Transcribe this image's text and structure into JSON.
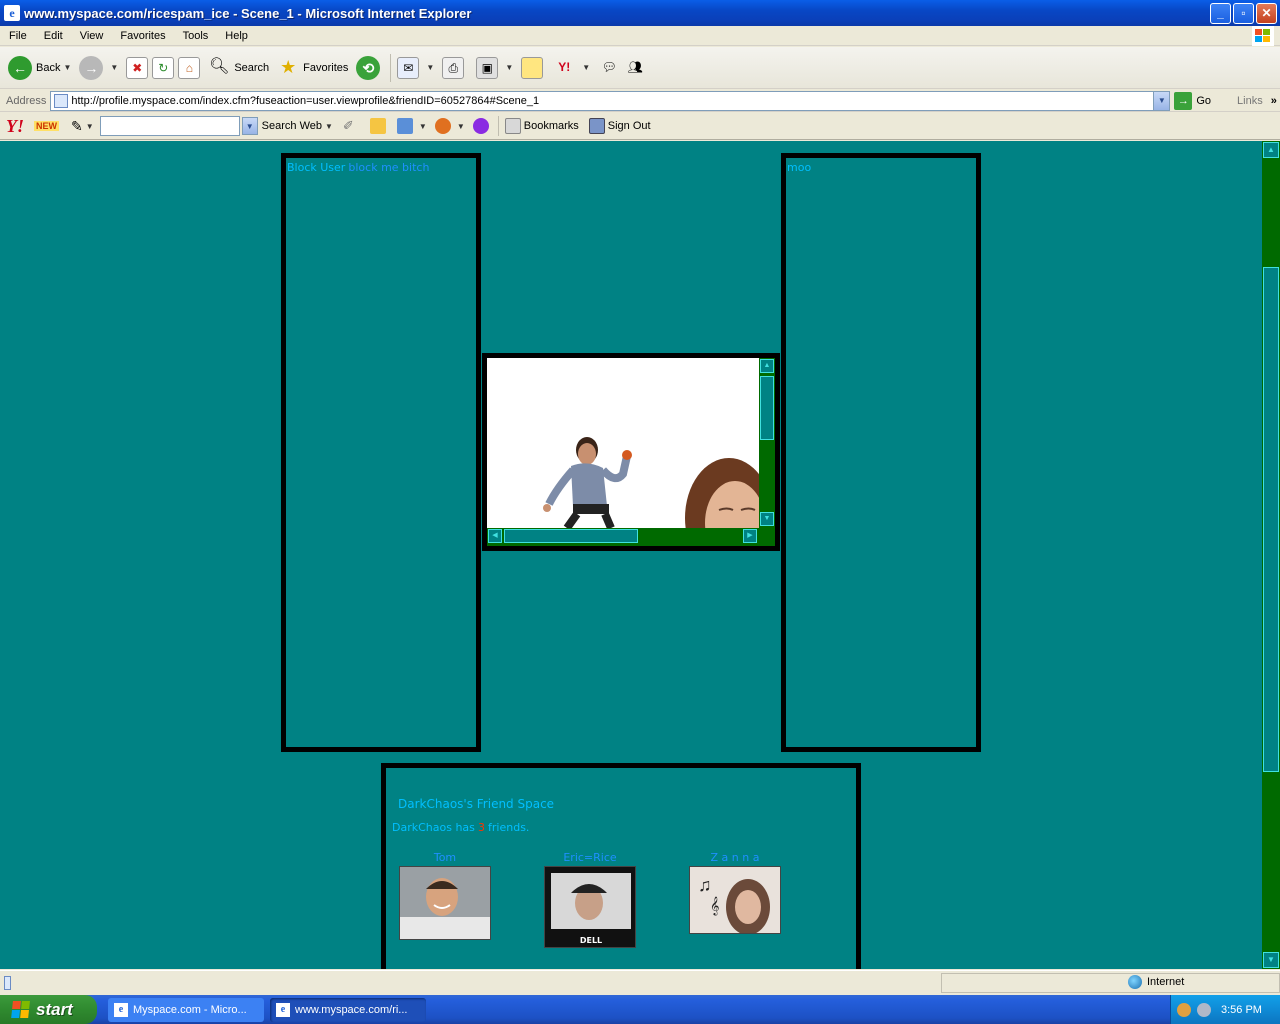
{
  "window": {
    "title": "www.myspace.com/ricespam_ice - Scene_1 - Microsoft Internet Explorer",
    "controls": [
      "minimize",
      "maximize",
      "close"
    ]
  },
  "menu": [
    "File",
    "Edit",
    "View",
    "Favorites",
    "Tools",
    "Help"
  ],
  "toolbar": {
    "back_label": "Back",
    "search_label": "Search",
    "favorites_label": "Favorites"
  },
  "address": {
    "label": "Address",
    "url": "http://profile.myspace.com/index.cfm?fuseaction=user.viewprofile&friendID=60527864#Scene_1",
    "go_label": "Go",
    "links_label": "Links"
  },
  "yahoo": {
    "logo": "Y!",
    "new_badge": "NEW",
    "search_web_label": "Search Web",
    "bookmarks_label": "Bookmarks",
    "signout_label": "Sign Out"
  },
  "page": {
    "left_panel": {
      "block_label": "Block User",
      "block_link": "block me bitch"
    },
    "right_panel": {
      "text": "moo"
    },
    "friend_space": {
      "heading": "DarkChaos's Friend Space",
      "count_prefix": "DarkChaos has",
      "count": "3",
      "count_suffix": "friends.",
      "friends": [
        {
          "name": "Tom"
        },
        {
          "name": "Eric=Rice"
        },
        {
          "name": "Z a n n a"
        }
      ]
    }
  },
  "status": {
    "zone": "Internet"
  },
  "taskbar": {
    "start_label": "start",
    "tasks": [
      "Myspace.com - Micro...",
      "www.myspace.com/ri..."
    ],
    "clock": "3:56 PM"
  },
  "colors": {
    "page_bg": "#008284",
    "scroll_track": "#006a00",
    "link": "#1e90ff",
    "count_color": "#ff3300"
  }
}
